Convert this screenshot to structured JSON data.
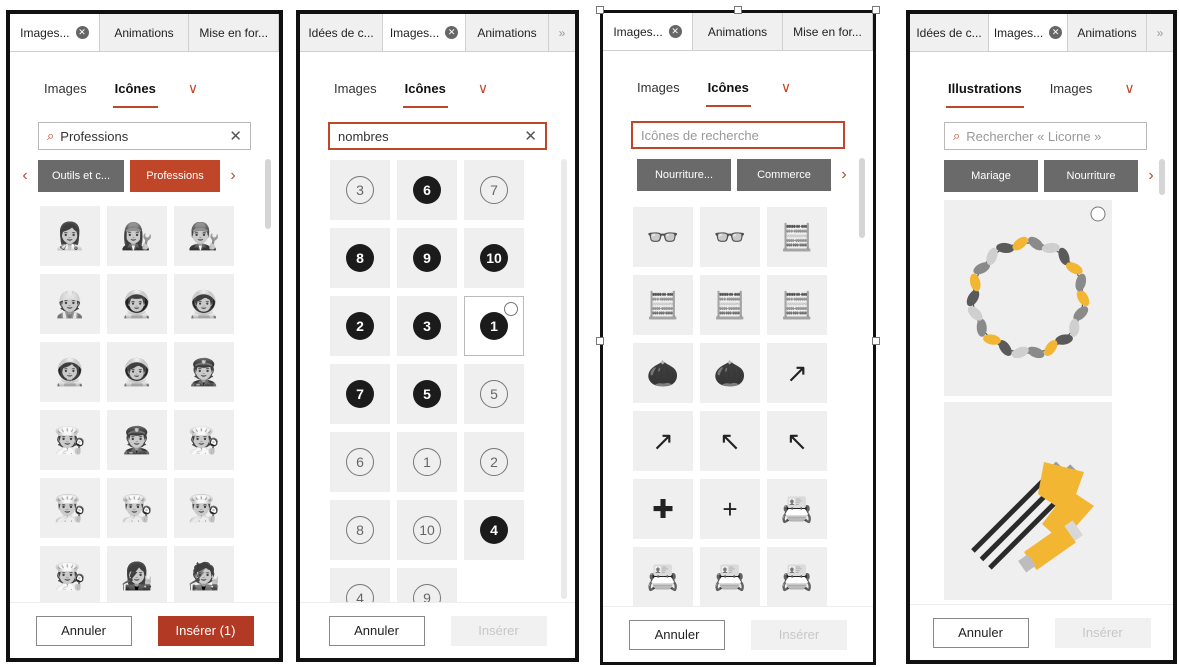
{
  "panel1": {
    "tabs": [
      {
        "label": "Images...",
        "close": "✕"
      },
      {
        "label": "Animations"
      },
      {
        "label": "Mise en for..."
      }
    ],
    "subtabs": [
      {
        "label": "Images"
      },
      {
        "label": "Icônes"
      }
    ],
    "chevron": "∨",
    "search": {
      "value": "Professions",
      "clear": "✕",
      "icon": "⌕"
    },
    "chips": [
      {
        "label": "Outils et c..."
      },
      {
        "label": "Professions"
      }
    ],
    "chip_prev": "‹",
    "chip_next": "›",
    "icons": [
      {
        "glyph": "👩‍⚕️"
      },
      {
        "glyph": "👩‍🔧"
      },
      {
        "glyph": "👨‍🔧"
      },
      {
        "glyph": "👷"
      },
      {
        "glyph": "👨‍🚀"
      },
      {
        "glyph": "🧑‍🚀"
      },
      {
        "glyph": "👩‍🚀"
      },
      {
        "glyph": "🧑‍🚀"
      },
      {
        "glyph": "👮"
      },
      {
        "glyph": "🧑‍🍳"
      },
      {
        "glyph": "👮"
      },
      {
        "glyph": "🧑‍🍳"
      },
      {
        "glyph": "👨‍🍳"
      },
      {
        "glyph": "👨‍🍳"
      },
      {
        "glyph": "👨‍🍳"
      },
      {
        "glyph": "🧑‍🍳"
      },
      {
        "glyph": "👩‍🎤"
      },
      {
        "glyph": "🧑‍🎤"
      }
    ],
    "cancel_label": "Annuler",
    "insert_label": "Insérer (1)"
  },
  "panel2": {
    "tabs": [
      {
        "label": "Idées de c..."
      },
      {
        "label": "Images...",
        "close": "✕"
      },
      {
        "label": "Animations"
      }
    ],
    "more": "»",
    "subtabs": [
      {
        "label": "Images"
      },
      {
        "label": "Icônes"
      }
    ],
    "chevron": "∨",
    "search": {
      "value": "nombres",
      "clear": "✕"
    },
    "numbers": [
      {
        "n": "3",
        "filled": false
      },
      {
        "n": "6",
        "filled": true
      },
      {
        "n": "7",
        "filled": false
      },
      {
        "n": "8",
        "filled": true
      },
      {
        "n": "9",
        "filled": true
      },
      {
        "n": "10",
        "filled": true
      },
      {
        "n": "2",
        "filled": true
      },
      {
        "n": "3",
        "filled": true
      },
      {
        "n": "1",
        "filled": true
      },
      {
        "n": "7",
        "filled": true
      },
      {
        "n": "5",
        "filled": true
      },
      {
        "n": "5",
        "filled": false
      },
      {
        "n": "6",
        "filled": false
      },
      {
        "n": "1",
        "filled": false
      },
      {
        "n": "2",
        "filled": false
      },
      {
        "n": "8",
        "filled": false
      },
      {
        "n": "10",
        "filled": false
      },
      {
        "n": "4",
        "filled": true
      },
      {
        "n": "4",
        "filled": false
      },
      {
        "n": "9",
        "filled": false
      }
    ],
    "cancel_label": "Annuler",
    "insert_label": "Insérer"
  },
  "panel3": {
    "tabs": [
      {
        "label": "Images...",
        "close": "✕"
      },
      {
        "label": "Animations"
      },
      {
        "label": "Mise en for..."
      }
    ],
    "subtabs": [
      {
        "label": "Images"
      },
      {
        "label": "Icônes"
      }
    ],
    "chevron": "∨",
    "search": {
      "placeholder": "Icônes de recherche"
    },
    "chips": [
      {
        "label": "Nourriture..."
      },
      {
        "label": "Commerce"
      }
    ],
    "chip_next": "›",
    "icons": [
      {
        "glyph": "👓"
      },
      {
        "glyph": "👓"
      },
      {
        "glyph": "🧮"
      },
      {
        "glyph": "🧮"
      },
      {
        "glyph": "🧮"
      },
      {
        "glyph": "🧮"
      },
      {
        "glyph": "🌰"
      },
      {
        "glyph": "🌰"
      },
      {
        "glyph": "↗"
      },
      {
        "glyph": "↗"
      },
      {
        "glyph": "↖"
      },
      {
        "glyph": "↖"
      },
      {
        "glyph": "✚"
      },
      {
        "glyph": "+"
      },
      {
        "glyph": "📇"
      },
      {
        "glyph": "📇"
      },
      {
        "glyph": "📇"
      },
      {
        "glyph": "📇"
      }
    ],
    "cancel_label": "Annuler",
    "insert_label": "Insérer"
  },
  "panel4": {
    "tabs": [
      {
        "label": "Idées de c..."
      },
      {
        "label": "Images...",
        "close": "✕"
      },
      {
        "label": "Animations"
      }
    ],
    "more": "»",
    "subtabs": [
      {
        "label": "Illustrations"
      },
      {
        "label": "Images"
      }
    ],
    "chevron": "∨",
    "search": {
      "placeholder": "Rechercher « Licorne »"
    },
    "chips": [
      {
        "label": "Mariage"
      },
      {
        "label": "Nourriture"
      }
    ],
    "chip_next": "›",
    "cancel_label": "Annuler",
    "insert_label": "Insérer"
  },
  "colors": {
    "accent": "#c0462a",
    "primary_button": "#b23a24",
    "chip": "#6a6a6a",
    "tile": "#efefef",
    "illustration_yellow": "#f2b632",
    "illustration_gray": "#8a8a8a"
  }
}
